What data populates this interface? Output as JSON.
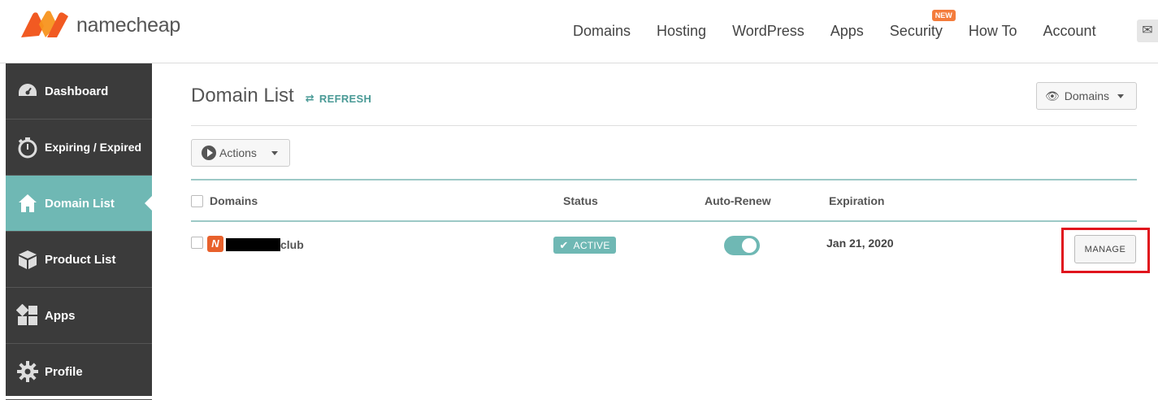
{
  "brand": {
    "name": "namecheap",
    "logo_color": "#f15a22"
  },
  "nav": {
    "items": [
      "Domains",
      "Hosting",
      "WordPress",
      "Apps",
      "Security",
      "How To",
      "Account"
    ],
    "security_badge": "NEW"
  },
  "sidebar": {
    "items": [
      {
        "label": "Dashboard",
        "icon": "dashboard-gauge-icon"
      },
      {
        "label": "Expiring / Expired",
        "icon": "stopwatch-icon"
      },
      {
        "label": "Domain List",
        "icon": "home-icon",
        "active": true
      },
      {
        "label": "Product List",
        "icon": "box-icon"
      },
      {
        "label": "Apps",
        "icon": "apps-grid-icon"
      },
      {
        "label": "Profile",
        "icon": "gear-icon"
      }
    ]
  },
  "main": {
    "title": "Domain List",
    "refresh_label": "REFRESH",
    "view_select": "Domains",
    "actions_label": "Actions",
    "table": {
      "columns": [
        "Domains",
        "Status",
        "Auto-Renew",
        "Expiration"
      ],
      "rows": [
        {
          "domain_suffix": "club",
          "status": "ACTIVE",
          "auto_renew": true,
          "expiration": "Jan 21, 2020",
          "manage_label": "MANAGE"
        }
      ]
    }
  },
  "colors": {
    "accent": "#6fb8b4",
    "sidebar_bg": "#3b3b3b",
    "highlight": "#e0141d",
    "badge": "#f47c3c"
  }
}
